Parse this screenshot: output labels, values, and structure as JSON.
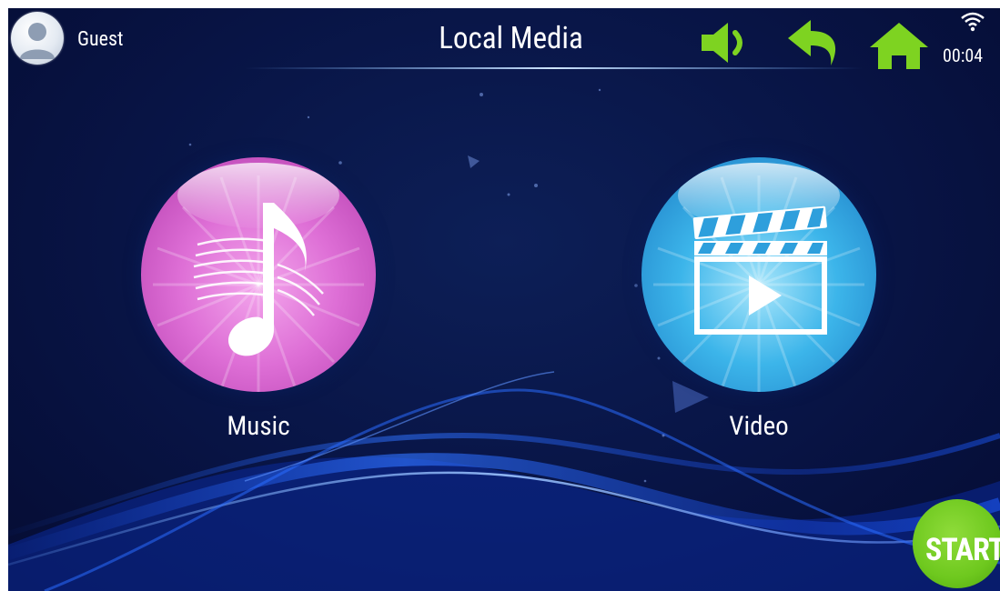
{
  "header": {
    "user_name": "Guest",
    "title": "Local Media",
    "clock": "00:04",
    "icons": {
      "avatar": "user-avatar-icon",
      "volume": "speaker-icon",
      "back": "back-arrow-icon",
      "home": "home-icon",
      "wifi": "wifi-icon"
    }
  },
  "apps": [
    {
      "label": "Music",
      "icon": "music-note-icon",
      "color": "#de6fd6"
    },
    {
      "label": "Video",
      "icon": "clapperboard-play-icon",
      "color": "#3cb5ea"
    }
  ],
  "start_button": {
    "label": "START",
    "color": "#6ec81e"
  },
  "colors": {
    "accent_green": "#7ed321",
    "background": "#081445"
  }
}
